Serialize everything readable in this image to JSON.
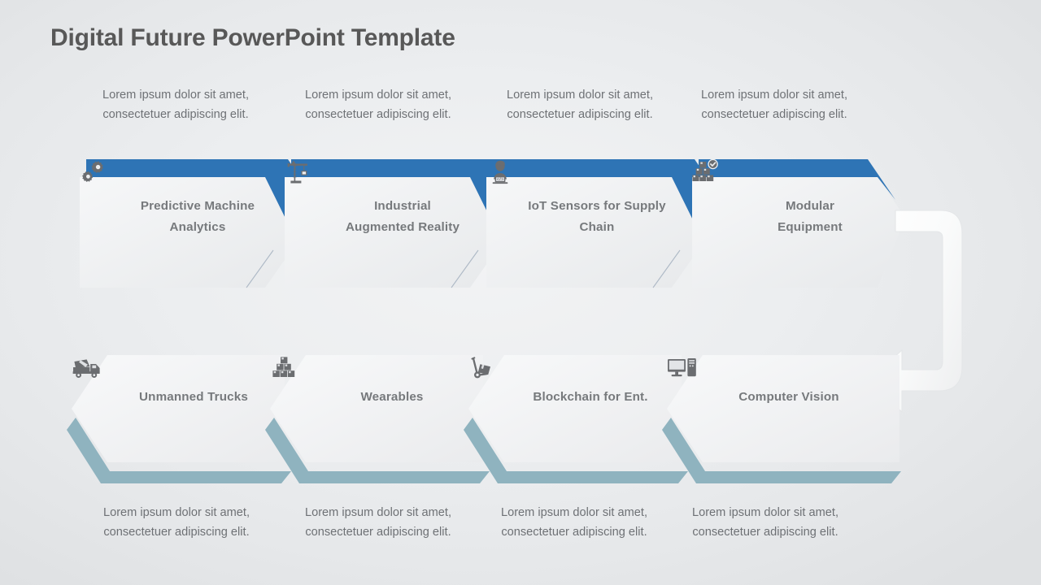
{
  "title": "Digital Future PowerPoint Template",
  "colors": {
    "accent_blue": "#2E74B5",
    "accent_teal": "#8FB3BF",
    "label_gray": "#76797c",
    "body_gray": "#6e7175",
    "title_gray": "#585858",
    "card_light": "#f4f5f6",
    "card_dark": "#e9eaec",
    "arrow_white": "#fbfbfc"
  },
  "lorem": "Lorem ipsum dolor sit amet, consectetuer adipiscing elit.",
  "top_row": [
    {
      "label": "Predictive Machine\nAnalytics",
      "icon": "gears-icon",
      "lorem": "Lorem ipsum dolor sit amet, consectetuer adipiscing elit."
    },
    {
      "label": "Industrial\nAugmented Reality",
      "icon": "crane-icon",
      "lorem": "Lorem ipsum dolor sit amet, consectetuer adipiscing elit."
    },
    {
      "label": "IoT Sensors  for Supply\nChain",
      "icon": "person-laptop-icon",
      "lorem": "Lorem ipsum dolor sit amet, consectetuer adipiscing elit."
    },
    {
      "label": "Modular\nEquipment",
      "icon": "boxes-check-icon",
      "lorem": "Lorem ipsum dolor sit amet, consectetuer adipiscing elit."
    }
  ],
  "bottom_row": [
    {
      "label": "Unmanned  Trucks",
      "icon": "cement-truck-icon",
      "lorem": "Lorem ipsum dolor sit amet, consectetuer adipiscing elit."
    },
    {
      "label": "Wearables",
      "icon": "box-stack-icon",
      "lorem": "Lorem ipsum dolor sit amet, consectetuer adipiscing elit."
    },
    {
      "label": "Blockchain  for Ent.",
      "icon": "hand-truck-icon",
      "lorem": "Lorem ipsum dolor sit amet, consectetuer adipiscing elit."
    },
    {
      "label": "Computer  Vision",
      "icon": "desktop-pc-icon",
      "lorem": "Lorem ipsum dolor sit amet, consectetuer adipiscing elit."
    }
  ],
  "connector": {
    "name": "loop-arrow",
    "direction": "left"
  }
}
